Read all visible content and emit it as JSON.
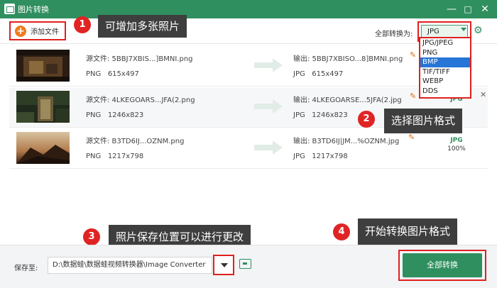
{
  "window": {
    "title": "图片转换",
    "controls": [
      "minimize-icon",
      "maximize-icon",
      "close-icon"
    ]
  },
  "toolbar": {
    "add_file_label": "添加文件",
    "convert_all_label": "全部转换为:",
    "selected_format": "JPG"
  },
  "format_options": [
    "JPG/JPEG",
    "PNG",
    "BMP",
    "TIF/TIFF",
    "WEBP",
    "DDS"
  ],
  "selected_option": "BMP",
  "files": [
    {
      "source_name": "源文件:  5BBJ7XBIS...]BMNI.png",
      "source_format": "PNG",
      "source_size": "615x497",
      "output_name": "输出:  5BBJ7XBISO...8]BMNI.png",
      "output_format": "JPG",
      "output_size": "615x497"
    },
    {
      "source_name": "源文件:  4LKEGOARS...JFA(2.png",
      "source_format": "PNG",
      "source_size": "1246x823",
      "output_name": "输出:  4LKEGOARSE...5JFA(2.jpg",
      "output_format": "JPG",
      "output_size": "1246x823",
      "badge_format": "JPG"
    },
    {
      "source_name": "源文件:  B3TD6IJ...OZNM.png",
      "source_format": "PNG",
      "source_size": "1217x798",
      "output_name": "输出:  B3TD6IJ|JM...%OZNM.jpg",
      "output_format": "JPG",
      "output_size": "1217x798",
      "badge_format": "JPG",
      "badge_percent": "100%"
    }
  ],
  "callouts": [
    {
      "num": "1",
      "text": "可增加多张照片"
    },
    {
      "num": "2",
      "text": "选择图片格式"
    },
    {
      "num": "3",
      "text": "照片保存位置可以进行更改"
    },
    {
      "num": "4",
      "text": "开始转换图片格式"
    }
  ],
  "bottom": {
    "save_to_label": "保存至:",
    "save_path": "D:\\数据蛙\\数据蛙视频转换器\\Image Converter",
    "convert_all_button": "全部转换"
  },
  "colors": {
    "brand_green": "#2f8f5f",
    "highlight_red": "#e02020",
    "callout_bg": "#3e3e3e",
    "selection_blue": "#2775d6",
    "add_icon_orange": "#f07c1c"
  }
}
